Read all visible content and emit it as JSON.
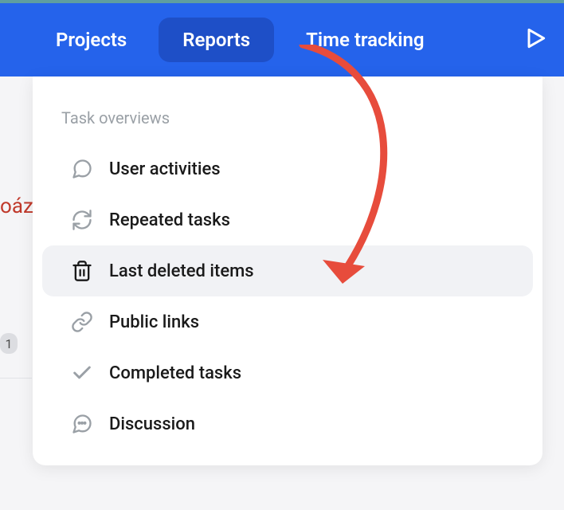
{
  "nav": {
    "items": [
      {
        "label": "Projects",
        "active": false
      },
      {
        "label": "Reports",
        "active": true
      },
      {
        "label": "Time tracking",
        "active": false
      }
    ]
  },
  "background": {
    "partial_text": "oáz",
    "badge_count": "1"
  },
  "dropdown": {
    "section_title": "Task overviews",
    "items": [
      {
        "icon": "comment-icon",
        "label": "User activities",
        "highlighted": false
      },
      {
        "icon": "refresh-icon",
        "label": "Repeated tasks",
        "highlighted": false
      },
      {
        "icon": "trash-icon",
        "label": "Last deleted items",
        "highlighted": true
      },
      {
        "icon": "link-icon",
        "label": "Public links",
        "highlighted": false
      },
      {
        "icon": "check-icon",
        "label": "Completed tasks",
        "highlighted": false
      },
      {
        "icon": "discussion-icon",
        "label": "Discussion",
        "highlighted": false
      }
    ]
  },
  "annotation": {
    "arrow_color": "#e74c3c"
  }
}
